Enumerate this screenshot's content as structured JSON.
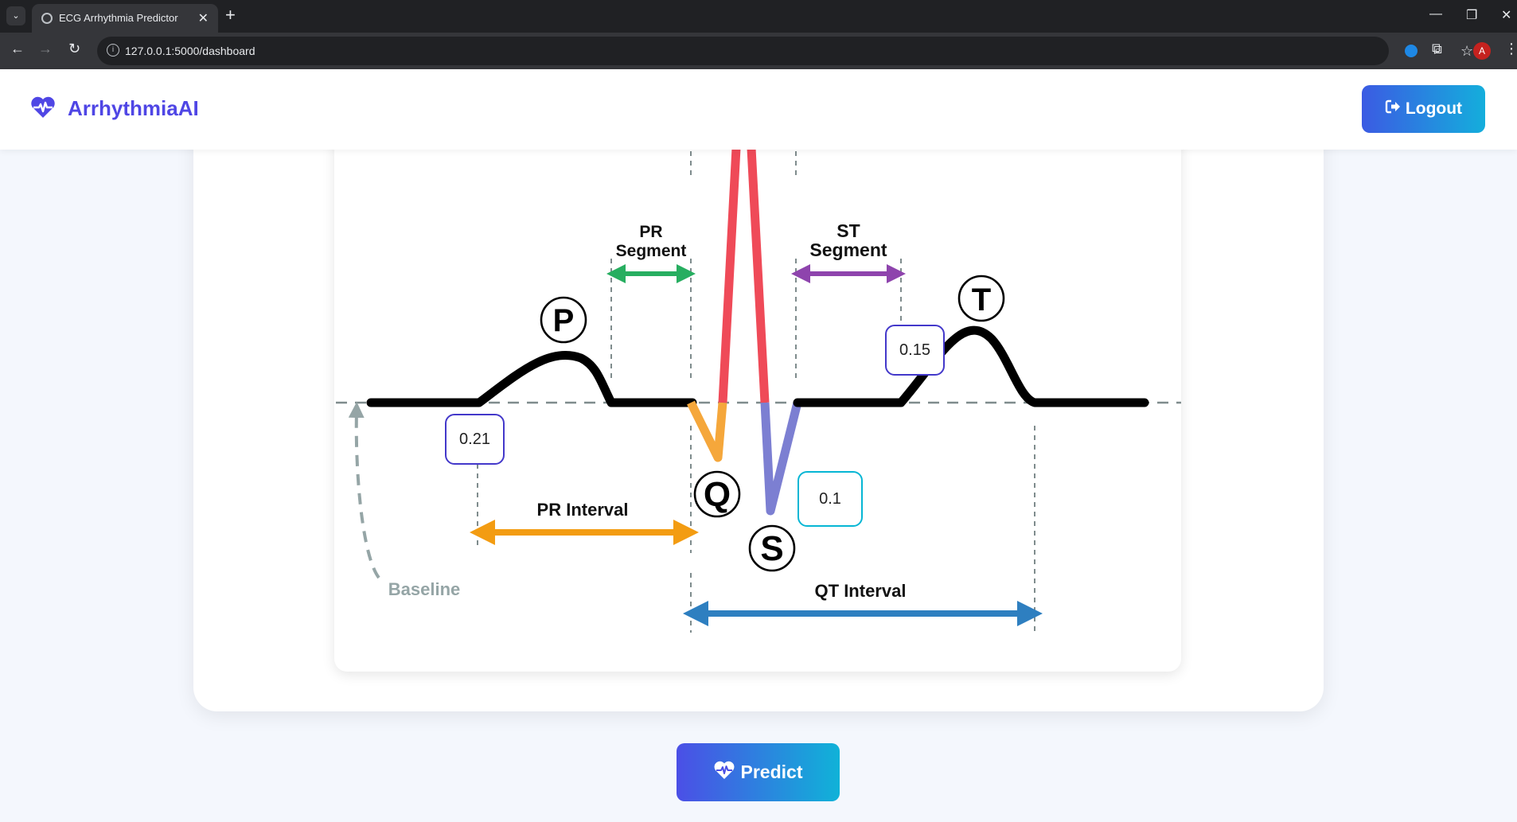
{
  "browser": {
    "tab_title": "ECG Arrhythmia Predictor",
    "url": "127.0.0.1:5000/dashboard",
    "profile_initial": "A"
  },
  "app": {
    "brand_name": "ArrhythmiaAI",
    "brand_color": "#4f46e5",
    "logout_label": "Logout",
    "predict_label": "Predict"
  },
  "diagram": {
    "wave_labels": {
      "p": "P",
      "q": "Q",
      "s": "S",
      "t": "T"
    },
    "pr_segment_line1": "PR",
    "pr_segment_line2": "Segment",
    "st_segment_line1": "ST",
    "st_segment_line2": "Segment",
    "pr_interval_label": "PR Interval",
    "qt_interval_label": "QT Interval",
    "baseline_label": "Baseline",
    "colors": {
      "r_wave": "#ef4a58",
      "q_wave": "#f5a73b",
      "s_wave": "#7c7fd2",
      "pr_segment_arrow": "#27ae60",
      "st_segment_arrow": "#8e44ad",
      "pr_interval_arrow": "#f39c12",
      "qt_interval_arrow": "#2e7fc0"
    }
  },
  "inputs": {
    "pr_interval_value": "0.21",
    "st_segment_value": "0.15",
    "qrs_value": "0.1"
  }
}
